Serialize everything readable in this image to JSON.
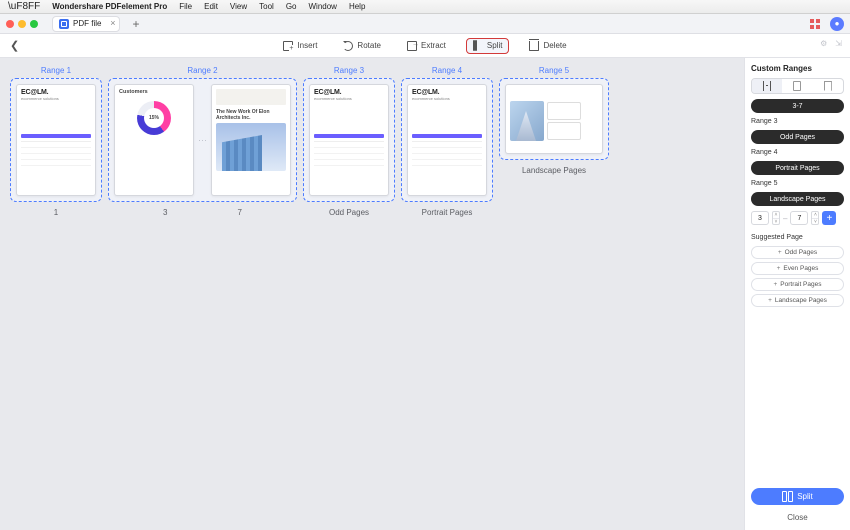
{
  "menubar": {
    "app_name": "Wondershare PDFelement Pro",
    "items": [
      "File",
      "Edit",
      "View",
      "Tool",
      "Go",
      "Window",
      "Help"
    ]
  },
  "tab": {
    "title": "PDF file"
  },
  "toolbar": {
    "insert": "Insert",
    "rotate": "Rotate",
    "extract": "Extract",
    "split": "Split",
    "delete": "Delete"
  },
  "ranges": [
    {
      "title": "Range 1",
      "caption": "1"
    },
    {
      "title": "Range 2",
      "caption_left": "3",
      "caption_right": "7"
    },
    {
      "title": "Range 3",
      "caption": "Odd Pages"
    },
    {
      "title": "Range 4",
      "caption": "Portrait Pages"
    },
    {
      "title": "Range 5",
      "caption": "Landscape Pages"
    }
  ],
  "thumb_content": {
    "brand": "EC@LM.",
    "sub": "ecommerce solutions",
    "customers_title": "Customers",
    "arch_title": "The New Work Of Elon Architects Inc."
  },
  "sidebar": {
    "title": "Custom Ranges",
    "current_range": "3-7",
    "defined": [
      {
        "label": "Range 3",
        "pill": "Odd Pages"
      },
      {
        "label": "Range 4",
        "pill": "Portrait Pages"
      },
      {
        "label": "Range 5",
        "pill": "Landscape Pages"
      }
    ],
    "from": "3",
    "to": "7",
    "suggested_title": "Suggested Page",
    "suggested": [
      "Odd Pages",
      "Even Pages",
      "Portrait Pages",
      "Landscape Pages"
    ],
    "split_btn": "Split",
    "close_btn": "Close"
  }
}
